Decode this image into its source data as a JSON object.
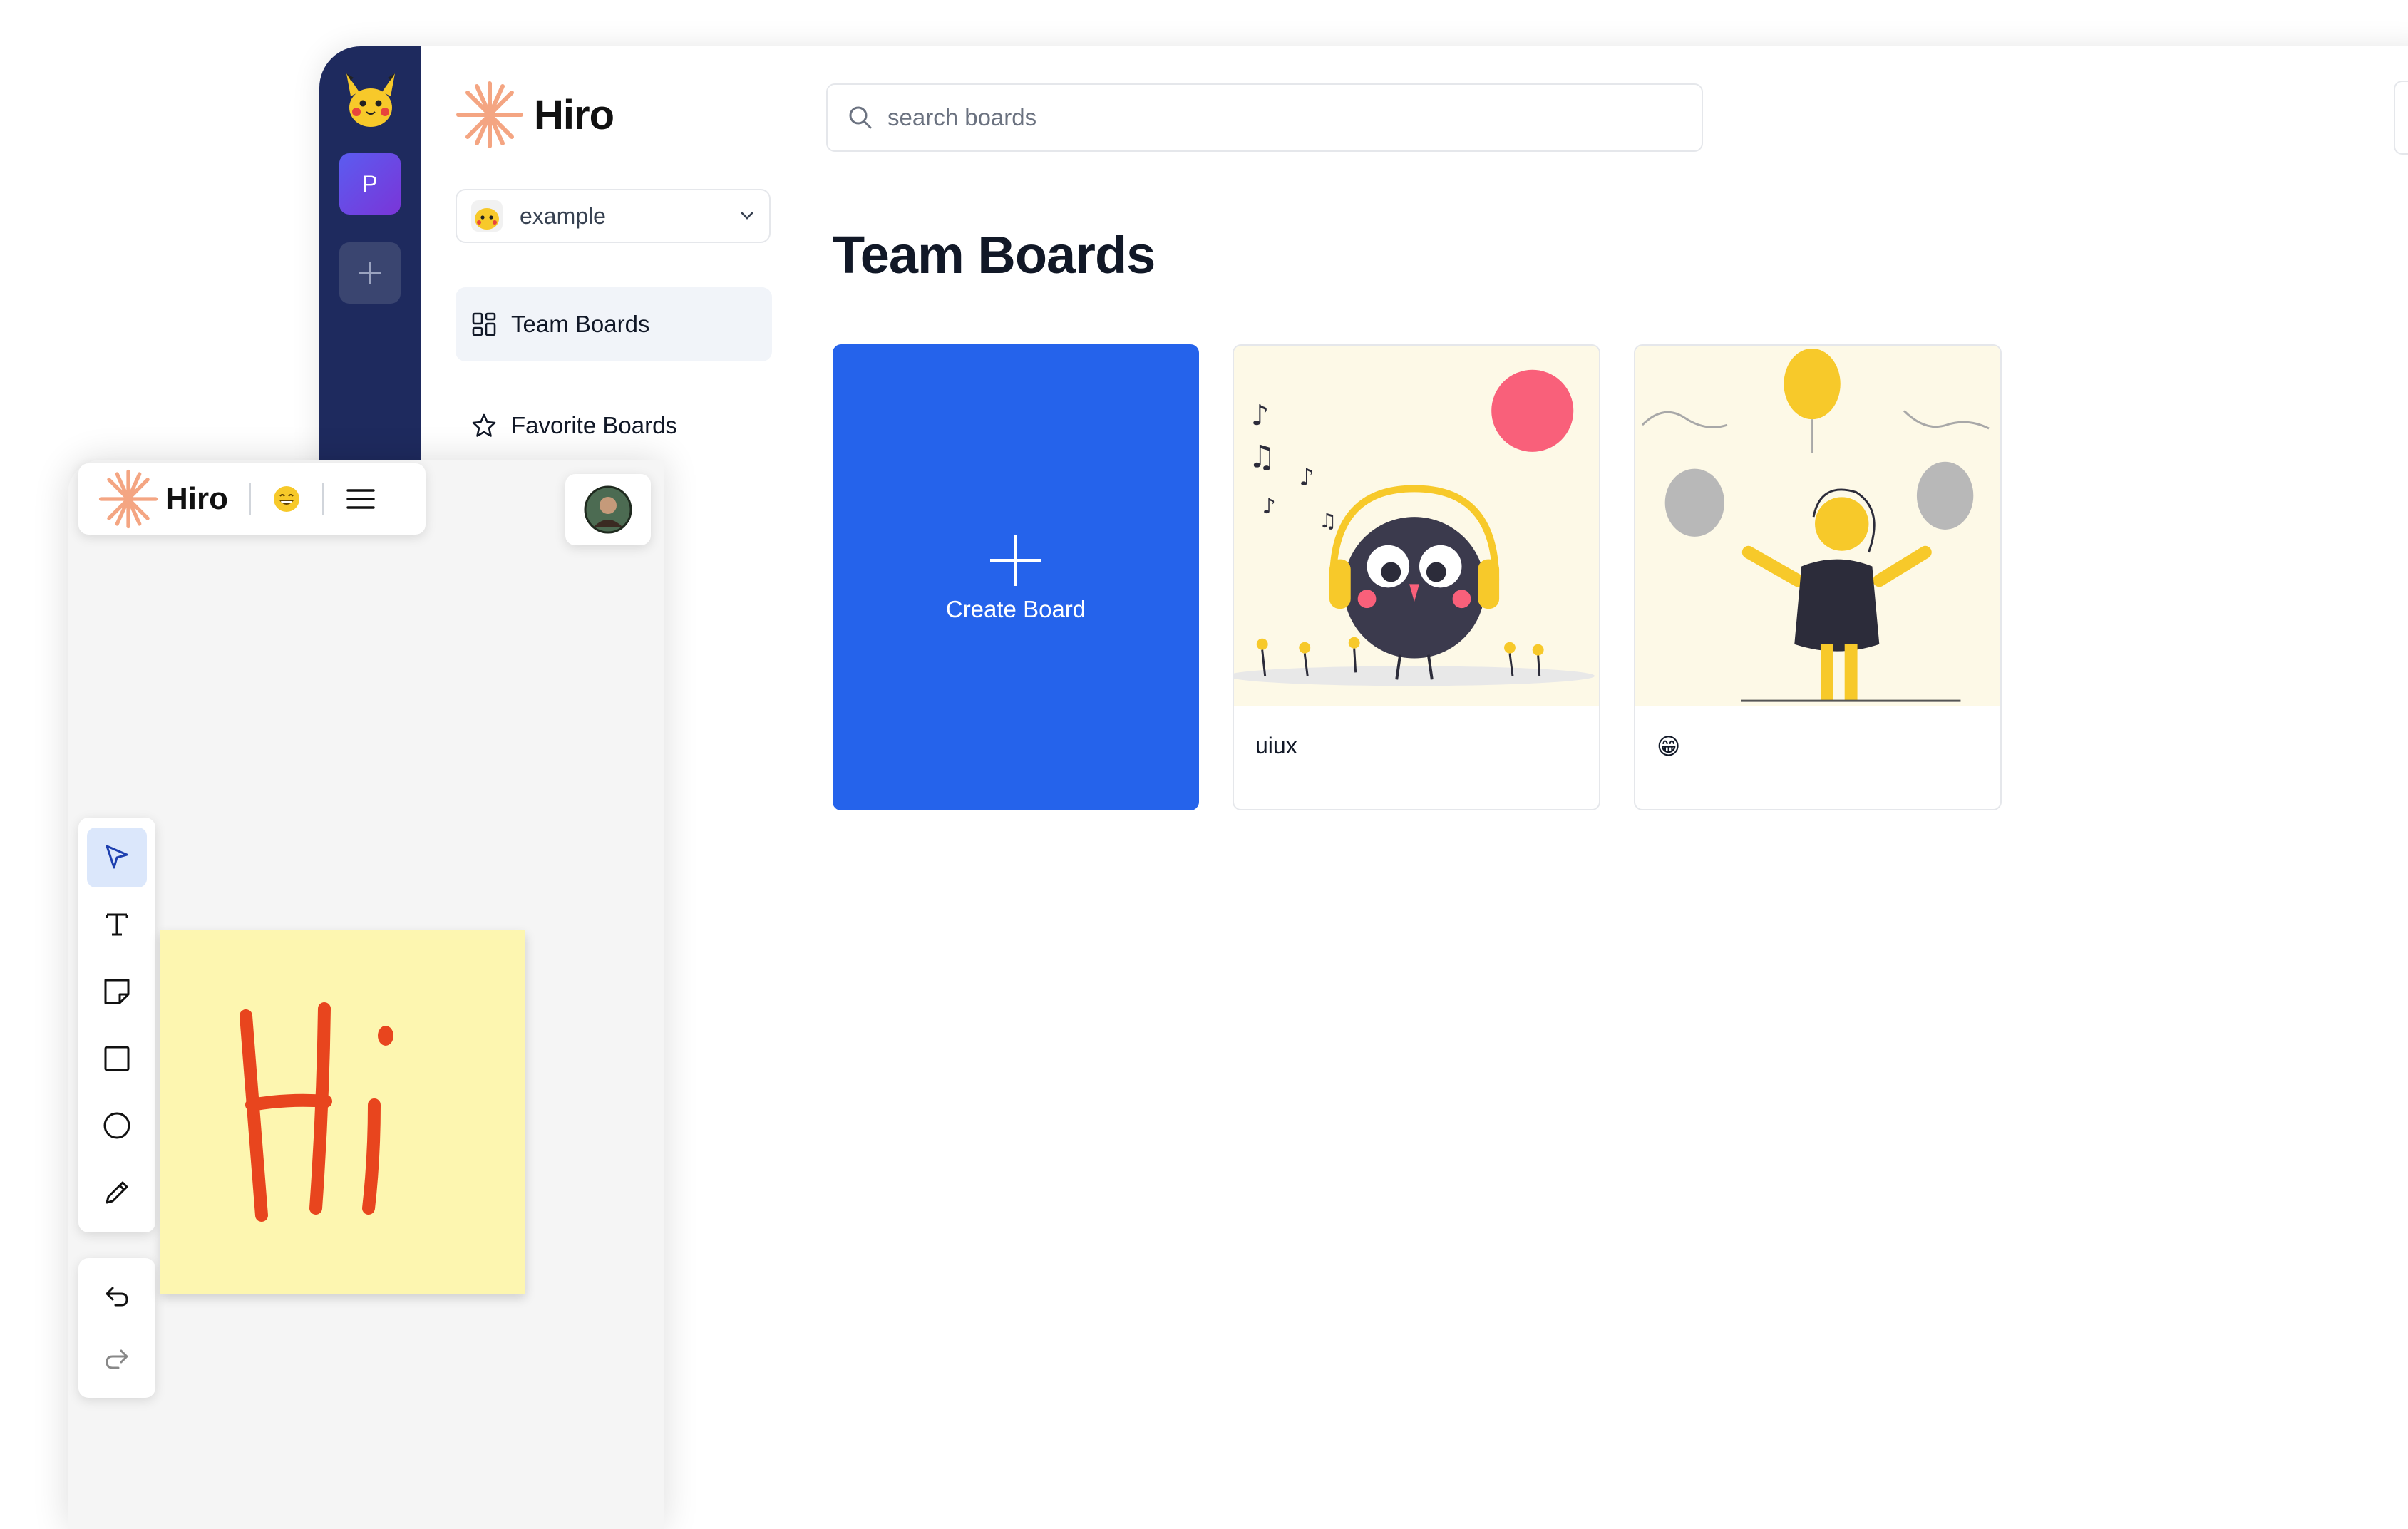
{
  "app": {
    "name": "Hiro",
    "colors": {
      "brand_star": "#f4a582",
      "rail": "#1e2a5e",
      "primary": "#2563eb",
      "thumb_bg": "#fdf9e7",
      "sticky": "#fdf6b0",
      "ink": "#e8451e"
    }
  },
  "rail": {
    "workspace_initial": "P",
    "icons": [
      "pikachu-logo-icon",
      "plus-icon"
    ]
  },
  "sidebar": {
    "brand": "Hiro",
    "org_select": {
      "value": "example"
    },
    "nav": [
      {
        "label": "Team Boards",
        "icon": "grid-icon",
        "active": true
      },
      {
        "label": "Favorite Boards",
        "icon": "star-icon",
        "active": false
      }
    ]
  },
  "search": {
    "placeholder": "search boards"
  },
  "main": {
    "title": "Team Boards",
    "create_label": "Create Board",
    "boards": [
      {
        "name": "uiux"
      },
      {
        "name": "😁"
      }
    ]
  },
  "board_editor": {
    "brand": "Hiro",
    "board_emoji": "😁",
    "tools": [
      "select-tool-icon",
      "text-tool-icon",
      "sticky-note-tool-icon",
      "rectangle-tool-icon",
      "circle-tool-icon",
      "pencil-tool-icon"
    ],
    "history": [
      "undo-icon",
      "redo-icon"
    ],
    "sticky_note_drawing": "Hi"
  }
}
